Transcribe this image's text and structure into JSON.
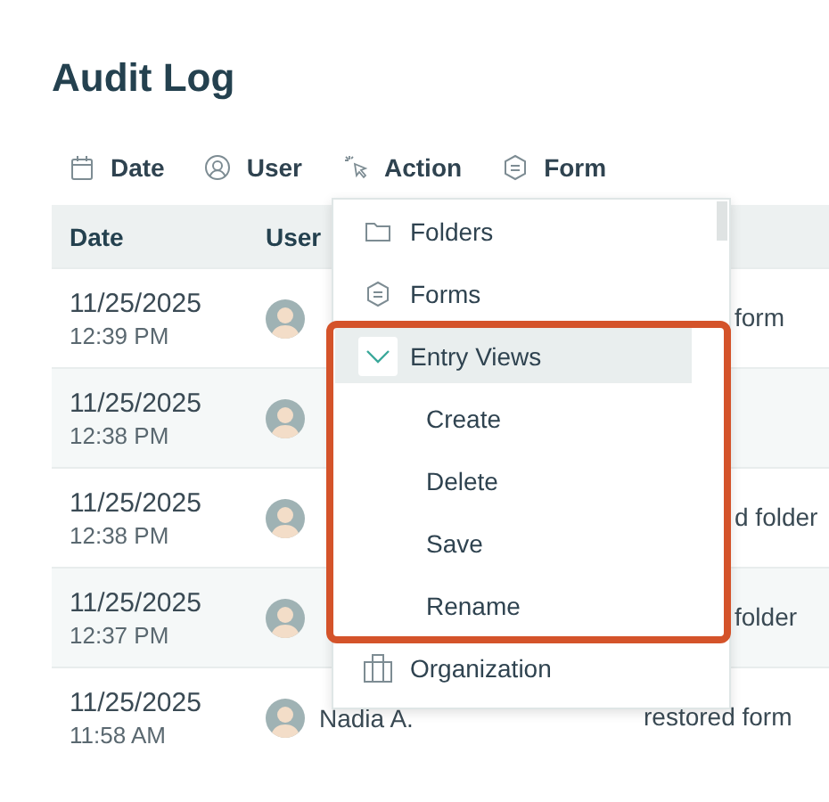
{
  "title": "Audit Log",
  "filters": [
    {
      "label": "Date",
      "kind": "calendar"
    },
    {
      "label": "User",
      "kind": "user"
    },
    {
      "label": "Action",
      "kind": "cursor"
    },
    {
      "label": "Form",
      "kind": "form"
    }
  ],
  "table": {
    "columns": [
      "Date",
      "User"
    ],
    "rows": [
      {
        "date": "11/25/2025",
        "time": "12:39 PM",
        "action": "form"
      },
      {
        "date": "11/25/2025",
        "time": "12:38 PM"
      },
      {
        "date": "11/25/2025",
        "time": "12:38 PM",
        "action": "d folder"
      },
      {
        "date": "11/25/2025",
        "time": "12:37 PM",
        "action": "folder"
      },
      {
        "date": "11/25/2025",
        "time": "11:58 AM",
        "user": "Nadia A.",
        "action": "restored form"
      }
    ]
  },
  "menu": {
    "items": [
      {
        "label": "Folders",
        "kind": "folder"
      },
      {
        "label": "Forms",
        "kind": "form"
      },
      {
        "label": "Entry Views",
        "kind": "group",
        "expanded": true,
        "highlighted": true,
        "children": [
          {
            "label": "Create"
          },
          {
            "label": "Delete"
          },
          {
            "label": "Save"
          },
          {
            "label": "Rename"
          }
        ]
      },
      {
        "label": "Organization",
        "kind": "organization"
      }
    ]
  }
}
